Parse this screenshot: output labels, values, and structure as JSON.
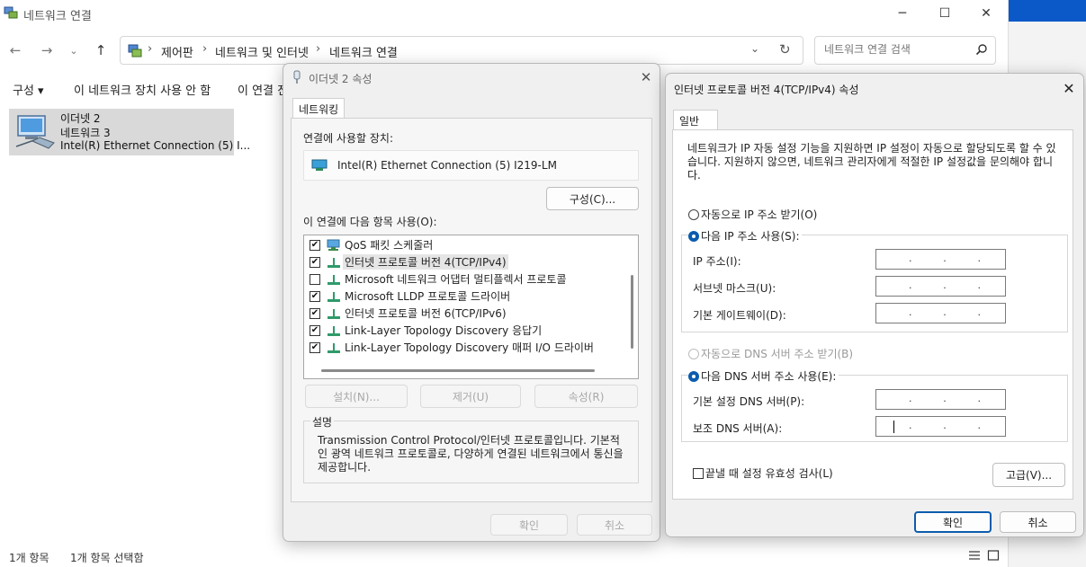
{
  "explorer": {
    "title": "네트워크 연결",
    "window_controls": {
      "minimize": "─",
      "maximize": "☐",
      "close": "✕"
    },
    "breadcrumb": [
      "제어판",
      "네트워크 및 인터넷",
      "네트워크 연결"
    ],
    "search_placeholder": "네트워크 연결 검색",
    "commands": {
      "organize": "구성 ▾",
      "disable": "이 네트워크 장치 사용 안 함",
      "connect": "이 연결 진"
    },
    "adapter": {
      "name": "이더넷 2",
      "network": "네트워크 3",
      "device": "Intel(R) Ethernet Connection (5) I..."
    },
    "status": {
      "count": "1개 항목",
      "selected": "1개 항목 선택함"
    }
  },
  "eth_dialog": {
    "title": "이더넷 2 속성",
    "close": "✕",
    "tab": "네트워킹",
    "connect_using_label": "연결에 사용할 장치:",
    "device_name": "Intel(R) Ethernet Connection (5) I219-LM",
    "configure_button": "구성(C)...",
    "items_label": "이 연결에 다음 항목 사용(O):",
    "items": [
      {
        "checked": true,
        "label": "QoS 패킷 스케줄러",
        "icon": "qos-icon"
      },
      {
        "checked": true,
        "label": "인터넷 프로토콜 버전 4(TCP/IPv4)",
        "icon": "protocol-icon"
      },
      {
        "checked": false,
        "label": "Microsoft 네트워크 어댑터 멀티플렉서 프로토콜",
        "icon": "protocol-icon"
      },
      {
        "checked": true,
        "label": "Microsoft LLDP 프로토콜 드라이버",
        "icon": "protocol-icon"
      },
      {
        "checked": true,
        "label": "인터넷 프로토콜 버전 6(TCP/IPv6)",
        "icon": "protocol-icon"
      },
      {
        "checked": true,
        "label": "Link-Layer Topology Discovery 응답기",
        "icon": "protocol-icon"
      },
      {
        "checked": true,
        "label": "Link-Layer Topology Discovery 매퍼 I/O 드라이버",
        "icon": "protocol-icon"
      }
    ],
    "install_button": "설치(N)...",
    "uninstall_button": "제거(U)",
    "properties_button": "속성(R)",
    "description_title": "설명",
    "description": "Transmission Control Protocol/인터넷 프로토콜입니다. 기본적인 광역 네트워크 프로토콜로, 다양하게 연결된 네트워크에서 통신을 제공합니다.",
    "ok_button": "확인",
    "cancel_button": "취소"
  },
  "ipv4_dialog": {
    "title": "인터넷 프로토콜 버전 4(TCP/IPv4) 속성",
    "close": "✕",
    "tab": "일반",
    "intro": "네트워크가 IP 자동 설정 기능을 지원하면 IP 설정이 자동으로 할당되도록 할 수 있습니다. 지원하지 않으면, 네트워크 관리자에게 적절한 IP 설정값을 문의해야 합니다.",
    "auto_ip": "자동으로 IP 주소 받기(O)",
    "manual_ip": "다음 IP 주소 사용(S):",
    "ip_address_label": "IP 주소(I):",
    "subnet_label": "서브넷 마스크(U):",
    "gateway_label": "기본 게이트웨이(D):",
    "auto_dns": "자동으로 DNS 서버 주소 받기(B)",
    "manual_dns": "다음 DNS 서버 주소 사용(E):",
    "preferred_dns_label": "기본 설정 DNS 서버(P):",
    "alternate_dns_label": "보조 DNS 서버(A):",
    "ip_dot": ".",
    "validate_label": "끝낼 때 설정 유효성 검사(L)",
    "advanced_button": "고급(V)...",
    "ok_button": "확인",
    "cancel_button": "취소"
  },
  "colors": {
    "accent": "#0b5cad",
    "selection": "#d9d9d9",
    "taskbar_blue": "#0b58c8"
  }
}
